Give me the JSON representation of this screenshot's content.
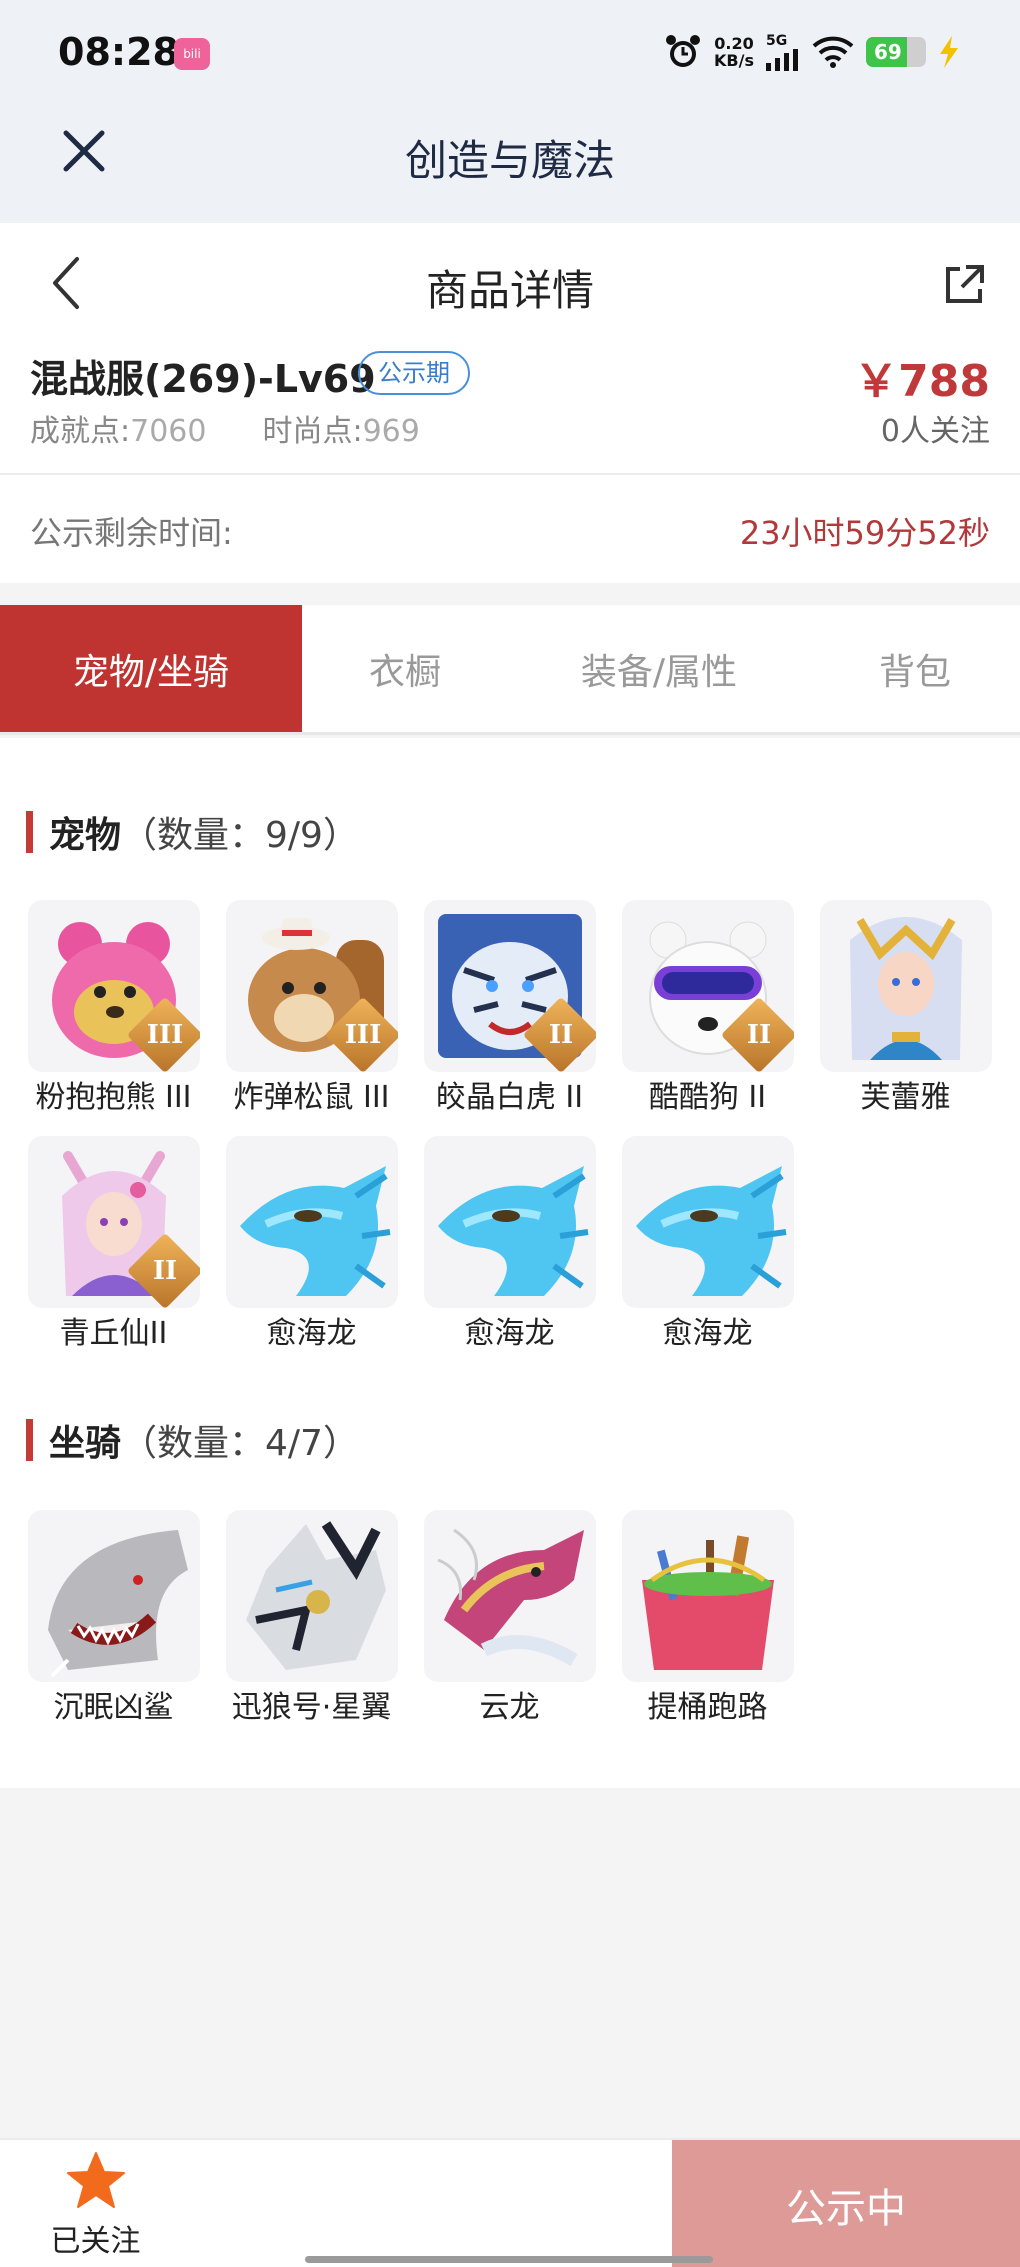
{
  "status_bar": {
    "time": "08:28",
    "app_icon": "bili",
    "net_speed_value": "0.20",
    "net_speed_unit": "KB/s",
    "network": "5G",
    "battery": "69",
    "battery_fraction": 0.69
  },
  "app_bar": {
    "title": "创造与魔法"
  },
  "detail": {
    "title": "商品详情"
  },
  "item": {
    "name": "混战服(269)-Lv69",
    "badge": "公示期",
    "price": "￥788",
    "achievement_label": "成就点:",
    "achievement_value": "7060",
    "fashion_label": "时尚点:",
    "fashion_value": "969",
    "followers": "0人关注"
  },
  "countdown": {
    "label": "公示剩余时间:",
    "value": "23小时59分52秒"
  },
  "tabs": [
    {
      "label": "宠物/坐骑",
      "active": true
    },
    {
      "label": "衣橱",
      "active": false
    },
    {
      "label": "装备/属性",
      "active": false
    },
    {
      "label": "背包",
      "active": false
    }
  ],
  "pets": {
    "title": "宠物",
    "count": "（数量：9/9）",
    "items": [
      {
        "name": "粉抱抱熊 III",
        "rank": "III",
        "icon": "pink-bear"
      },
      {
        "name": "炸弹松鼠 III",
        "rank": "III",
        "icon": "squirrel"
      },
      {
        "name": "皎晶白虎 II",
        "rank": "II",
        "icon": "white-tiger"
      },
      {
        "name": "酷酷狗 II",
        "rank": "II",
        "icon": "cool-dog"
      },
      {
        "name": "芙蕾雅",
        "rank": "",
        "icon": "freya"
      },
      {
        "name": "青丘仙II",
        "rank": "II",
        "icon": "fox-fairy"
      },
      {
        "name": "愈海龙",
        "rank": "",
        "icon": "sea-dragon"
      },
      {
        "name": "愈海龙",
        "rank": "",
        "icon": "sea-dragon"
      },
      {
        "name": "愈海龙",
        "rank": "",
        "icon": "sea-dragon"
      }
    ]
  },
  "mounts": {
    "title": "坐骑",
    "count": "（数量：4/7）",
    "items": [
      {
        "name": "沉眠凶鲨",
        "icon": "shark"
      },
      {
        "name": "迅狼号·星翼",
        "icon": "mech-wolf"
      },
      {
        "name": "云龙",
        "icon": "cloud-dragon"
      },
      {
        "name": "提桶跑路",
        "icon": "bucket"
      }
    ]
  },
  "bottom": {
    "follow_label": "已关注",
    "status_button": "公示中"
  },
  "colors": {
    "accent_red": "#bf3330",
    "price_red": "#c0393a",
    "badge_blue": "#3a7ec9",
    "status_button": "#dd9a97",
    "star": "#f26a1b"
  }
}
